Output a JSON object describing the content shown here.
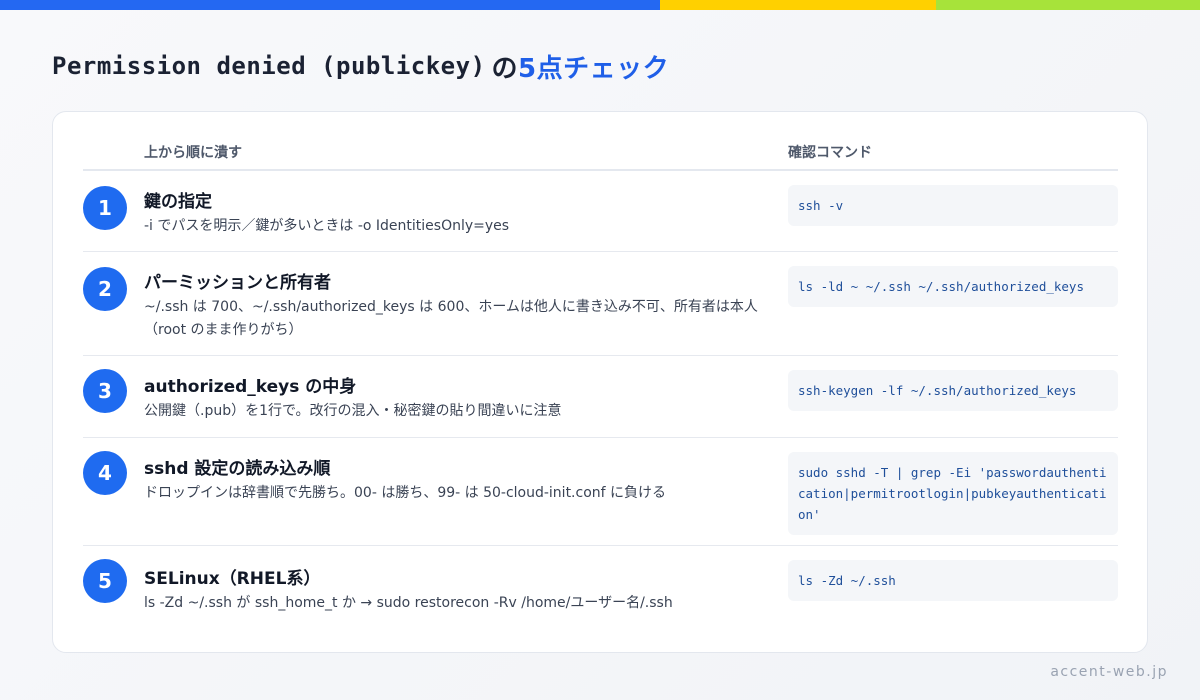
{
  "colors": {
    "accent": "#1f6bf0",
    "bar_blue": "#2468f2",
    "bar_yellow": "#ffd000",
    "bar_green": "#a7e33a"
  },
  "title": {
    "mono": "Permission denied (publickey)",
    "no": "の",
    "accent": "5点チェック"
  },
  "table": {
    "header_step": "上から順に潰す",
    "header_cmd": "確認コマンド"
  },
  "rows": [
    {
      "num": "1",
      "title": "鍵の指定",
      "desc": "-i でパスを明示／鍵が多いときは -o IdentitiesOnly=yes",
      "cmd": "ssh -v"
    },
    {
      "num": "2",
      "title": "パーミッションと所有者",
      "desc": "~/.ssh は 700、~/.ssh/authorized_keys は 600、ホームは他人に書き込み不可、所有者は本人（root のまま作りがち）",
      "cmd": "ls -ld ~ ~/.ssh ~/.ssh/authorized_keys"
    },
    {
      "num": "3",
      "title": "authorized_keys の中身",
      "desc": "公開鍵（.pub）を1行で。改行の混入・秘密鍵の貼り間違いに注意",
      "cmd": "ssh-keygen -lf ~/.ssh/authorized_keys"
    },
    {
      "num": "4",
      "title": "sshd 設定の読み込み順",
      "desc": "ドロップインは辞書順で先勝ち。00- は勝ち、99- は 50-cloud-init.conf に負ける",
      "cmd": "sudo sshd -T | grep -Ei 'passwordauthentication|permitrootlogin|pubkeyauthentication'"
    },
    {
      "num": "5",
      "title": "SELinux（RHEL系）",
      "desc": "ls -Zd ~/.ssh が ssh_home_t か → sudo restorecon -Rv /home/ユーザー名/.ssh",
      "cmd": "ls -Zd ~/.ssh"
    }
  ],
  "footer": "accent-web.jp"
}
